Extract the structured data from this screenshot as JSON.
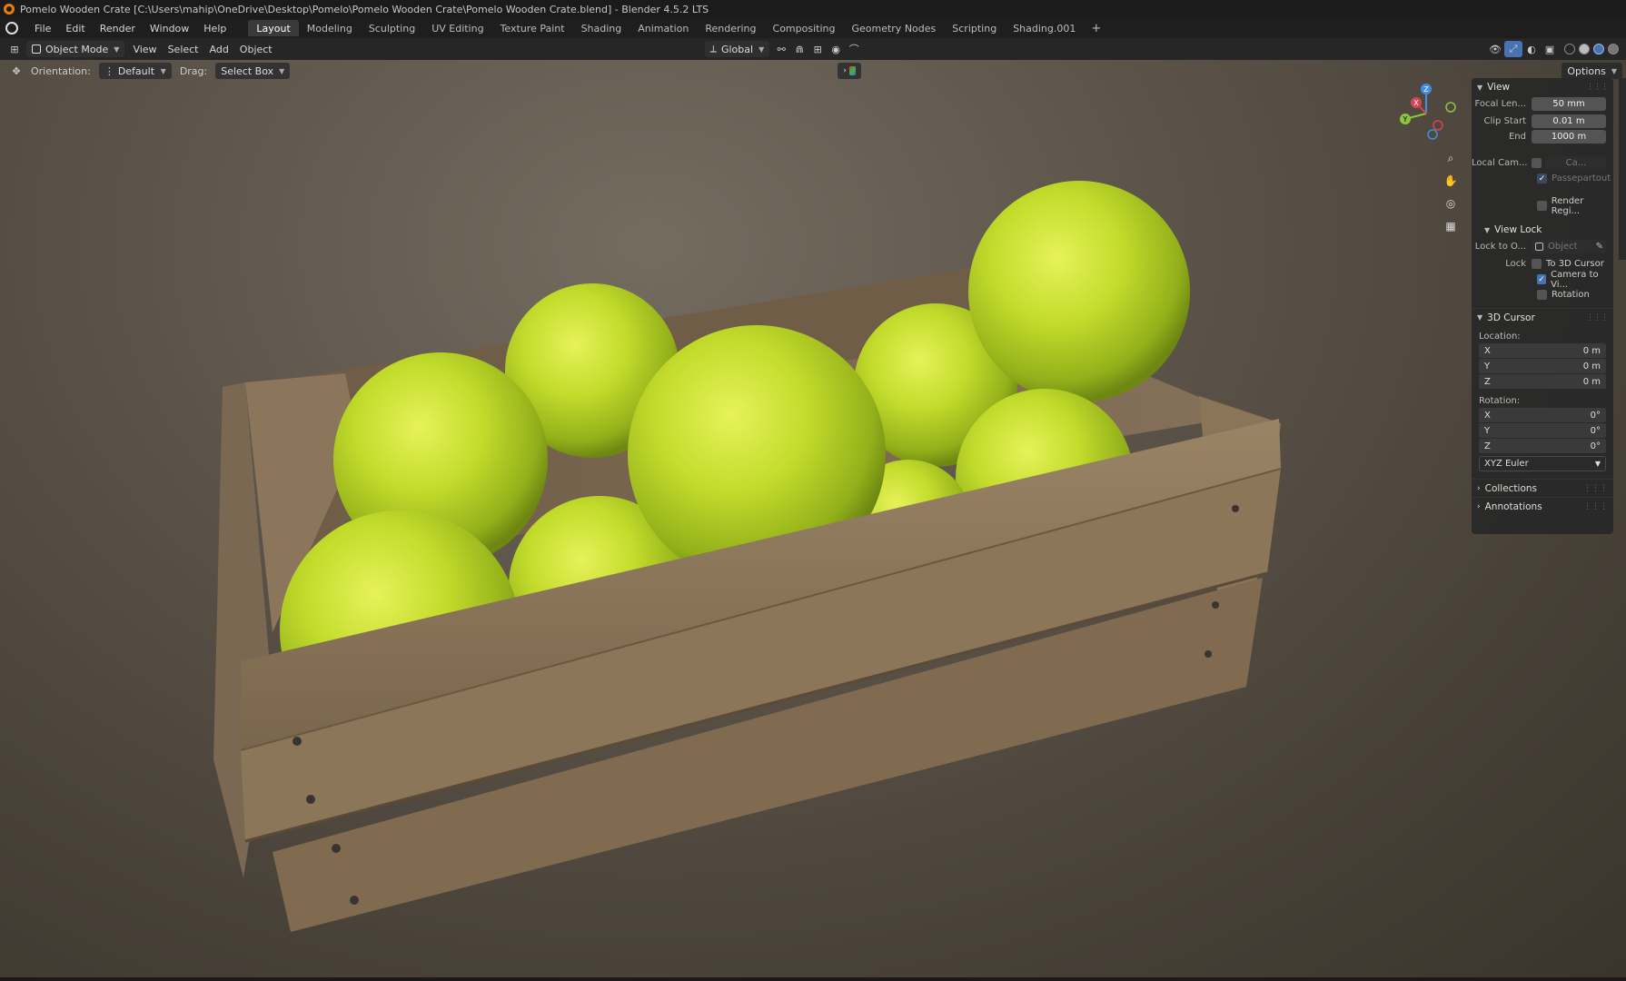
{
  "titlebar": {
    "text": "Pomelo Wooden Crate [C:\\Users\\mahip\\OneDrive\\Desktop\\Pomelo\\Pomelo Wooden Crate\\Pomelo Wooden Crate.blend] - Blender 4.5.2 LTS"
  },
  "menu": {
    "items": [
      "File",
      "Edit",
      "Render",
      "Window",
      "Help"
    ]
  },
  "workspaces": {
    "tabs": [
      "Layout",
      "Modeling",
      "Sculpting",
      "UV Editing",
      "Texture Paint",
      "Shading",
      "Animation",
      "Rendering",
      "Compositing",
      "Geometry Nodes",
      "Scripting",
      "Shading.001"
    ],
    "active": "Layout"
  },
  "header": {
    "mode": "Object Mode",
    "menus": [
      "View",
      "Select",
      "Add",
      "Object"
    ],
    "transform_orientation": "Global"
  },
  "toolheader": {
    "orientation_label": "Orientation:",
    "orientation_value": "Default",
    "drag_label": "Drag:",
    "drag_value": "Select Box",
    "options": "Options"
  },
  "gizmo": {
    "x": "X",
    "y": "Y",
    "z": "Z"
  },
  "npanel": {
    "view": {
      "title": "View",
      "focal_label": "Focal Len...",
      "focal_value": "50 mm",
      "clip_start_label": "Clip Start",
      "clip_start_value": "0.01 m",
      "end_label": "End",
      "end_value": "1000 m",
      "local_cam_label": "Local Cam...",
      "local_cam_value": "Ca...",
      "passepartout": "Passepartout",
      "render_region": "Render Regi..."
    },
    "view_lock": {
      "title": "View Lock",
      "lock_to_label": "Lock to O...",
      "lock_to_value": "Object",
      "lock_label": "Lock",
      "to_cursor": "To 3D Cursor",
      "camera_to_view": "Camera to Vi...",
      "rotation": "Rotation"
    },
    "cursor": {
      "title": "3D Cursor",
      "location_label": "Location:",
      "loc": [
        {
          "axis": "X",
          "value": "0 m"
        },
        {
          "axis": "Y",
          "value": "0 m"
        },
        {
          "axis": "Z",
          "value": "0 m"
        }
      ],
      "rotation_label": "Rotation:",
      "rot": [
        {
          "axis": "X",
          "value": "0°"
        },
        {
          "axis": "Y",
          "value": "0°"
        },
        {
          "axis": "Z",
          "value": "0°"
        }
      ],
      "rotation_mode": "XYZ Euler"
    },
    "collections": "Collections",
    "annotations": "Annotations"
  },
  "colors": {
    "accent": "#4772b3",
    "active_tab": "#3a3a3a",
    "x_axis": "#d64554",
    "y_axis": "#8cc63f",
    "z_axis": "#3f8ee0",
    "fruit": "#c8e03a",
    "wood": "#8a7458"
  }
}
